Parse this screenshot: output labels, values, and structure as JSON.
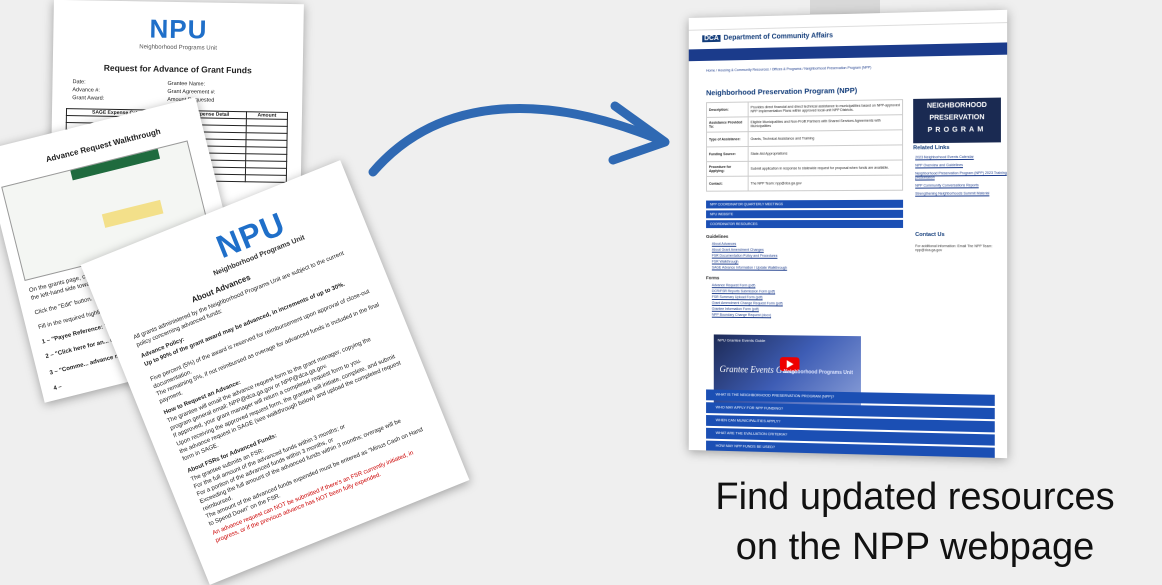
{
  "paper1": {
    "logo": "NPU",
    "logo_sub": "Neighborhood Programs Unit",
    "title": "Request for Advance of Grant Funds",
    "fields_left": [
      "Date:",
      "Advance #:",
      "Grant Award:"
    ],
    "fields_right": [
      "Grantee Name:",
      "Grant Agreement #:",
      "Amount Requested"
    ],
    "table_headers": [
      "SAGE Expense Category",
      "Expense Detail",
      "Amount"
    ]
  },
  "paper2": {
    "title": "Advance Request Walkthrough",
    "steps": [
      "On the grants page, click \"Give an Advance or Re...",
      "the left-hand side towards the bottom under",
      "Click the \"Edit\" button.",
      "Fill in the required highlighted fie...",
      "1 – \"Payee Reference: This r...",
      "2 – \"Click here for an... request form",
      "3 – \"Comme... advance r...",
      "4 –"
    ]
  },
  "paper3": {
    "logo": "NPU",
    "logo_sub": "Neighborhood Programs Unit",
    "heading": "About Advances",
    "intro": "All grants administered by the Neighborhood Programs Unit are subject to the current policy concerning advanced funds:",
    "policy_title": "Advance Policy:",
    "policy_lines": [
      "Up to 90% of the grant award may be advanced, in increments of up to 30%.",
      "Five percent (5%) of the award is reserved for reimbursement upon approval of close-out documentation.",
      "The remaining 5%, if not reimbursed as overage for advanced funds is included in the final payment."
    ],
    "how_title": "How to Request an Advance:",
    "how_lines": [
      "The grantee will email the advance request form to the grant manager, copying the program general email: NPP@dca.ga.gov or NPP@dca.ga.gov.",
      "If approved, your grant manager will return a completed request form to you.",
      "Upon receiving the approved request form, the grantee will initiate, complete, and submit the advance request in SAGE (see walkthrough below) and upload the completed request form in SAGE."
    ],
    "fsr_title": "About FSRs for Advanced Funds:",
    "fsr_lines": [
      "The grantee submits an FSR:",
      "For the full amount of the advanced funds within 3 months; or",
      "For a portion of the advanced funds within 3 months, or",
      "Exceeding the full amount of the advanced funds within 3 months; overage will be reimbursed.",
      "The amount of the advanced funds expended must be entered as \"Minus Cash on Hand to Spend Down\" on the FSR."
    ],
    "warning": "An advance request can NOT be submitted if there's an FSR currently initiated, in progress, or if the previous advance has NOT been fully expended."
  },
  "webpage": {
    "dept": "Department of Community Affairs",
    "dept_abbr": "DCA",
    "breadcrumb": "Home / Housing & Community Resources / Offices & Programs / Neighborhood Preservation Program (NPP)",
    "title": "Neighborhood Preservation Program (NPP)",
    "info_rows": [
      {
        "label": "Description:",
        "value": "Provides direct financial and direct technical assistance to municipalities based on NPP-approved NPP Implementation Plans within approved local-unit NPP Districts."
      },
      {
        "label": "Assistance Provided To:",
        "value": "Eligible Municipalities and Non-Profit Partners with Shared Services Agreements with Municipalities"
      },
      {
        "label": "Type of Assistance:",
        "value": "Grants, Technical Assistance and Training"
      },
      {
        "label": "Funding Source:",
        "value": "State-Aid Appropriations"
      },
      {
        "label": "Procedure for Applying:",
        "value": "Submit application in response to statewide request for proposal when funds are available."
      },
      {
        "label": "Contact:",
        "value": "The NPP Team: npp@dca.ga.gov"
      }
    ],
    "banner": [
      "NEIGHBORHOOD",
      "PRESERVATION",
      "PROGRAM"
    ],
    "related_title": "Related Links",
    "related_links": [
      "2023 Neighborhood Events Calendar",
      "NPP Overview and Guidelines",
      "Neighborhood Preservation Program (NPP) 2023 Training presentation",
      "NPP Community Conversations Reports",
      "Strengthening Neighborhoods Summit Material"
    ],
    "accordions_top": [
      "NPP COORDINATOR QUARTERLY MEETINGS",
      "NPU WEBSITE",
      "COORDINATOR RESOURCES"
    ],
    "guidelines_title": "Guidelines",
    "guideline_links": [
      "About Advances",
      "About Grant Amendment Changes",
      "FSR Documentation Policy and Procedures",
      "FSR Walkthrough",
      "SAGE Advance Information / Update Walkthrough"
    ],
    "forms_title": "Forms",
    "form_links": [
      "Advance Request Form (pdf)",
      "DCR/FSR Reports Submission Form (pdf)",
      "FSR Summary Upload Form (pdf)",
      "Grant Amendment Change Request Form (pdf)",
      "Grantee Information Form (pdf)",
      "NPP Boundary Change Request (docx)"
    ],
    "video_title": "NPU Grantee Events Guide",
    "video_text": "Grantee Events Guide",
    "video_brand": "Neighborhood Programs Unit",
    "contact_title": "Contact Us",
    "contact_text": "For additional information: Email The NPP Team: npp@dca.ga.gov",
    "accordions_bottom": [
      "WHAT IS THE NEIGHBORHOOD PRESERVATION PROGRAM (NPP)?",
      "WHO MAY APPLY FOR NPP FUNDING?",
      "WHEN CAN MUNICIPALITIES APPLY?",
      "WHAT ARE THE EVALUATION CRITERIA?",
      "HOW MAY NPP FUNDS BE USED?"
    ]
  },
  "caption": [
    "Find updated resources",
    "on the NPP webpage"
  ],
  "colors": {
    "arrow": "#2f69b3",
    "nav": "#1b3b8b",
    "accordion": "#1b4fb4",
    "logo": "#1f6fc9"
  }
}
